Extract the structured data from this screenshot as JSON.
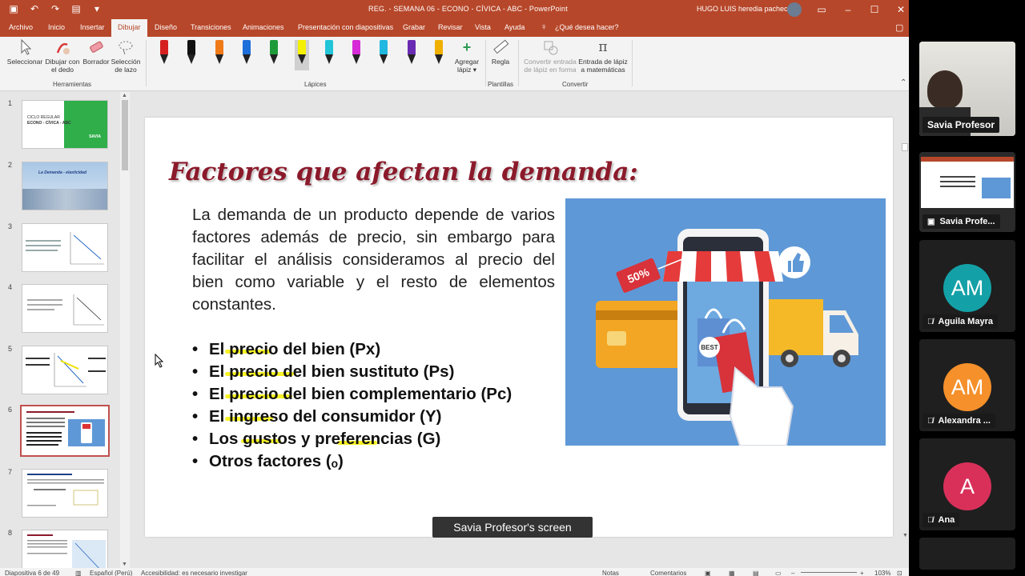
{
  "window": {
    "title": "REG. - SEMANA 06 - ECONO - CÍVICA - ABC  -  PowerPoint",
    "user": "HUGO LUIS heredia pacheco"
  },
  "tabs": [
    "Archivo",
    "Inicio",
    "Insertar",
    "Dibujar",
    "Diseño",
    "Transiciones",
    "Animaciones",
    "Presentación con diapositivas",
    "Grabar",
    "Revisar",
    "Vista",
    "Ayuda"
  ],
  "active_tab": "Dibujar",
  "tell_me": "¿Qué desea hacer?",
  "ribbon": {
    "tools": {
      "select": "Seleccionar",
      "draw_finger_1": "Dibujar con",
      "draw_finger_2": "el dedo",
      "eraser": "Borrador",
      "lasso_1": "Selección",
      "lasso_2": "de lazo",
      "group": "Herramientas"
    },
    "pens_group": "Lápices",
    "add_pen_1": "Agregar",
    "add_pen_2": "lápiz",
    "ruler": "Regla",
    "stencils_group": "Plantillas",
    "convert_shape_1": "Convertir entrada",
    "convert_shape_2": "de lápiz en forma",
    "convert_math_1": "Entrada de lápiz",
    "convert_math_2": "a matemáticas",
    "convert_group": "Convertir",
    "pen_colors": [
      "#d62020",
      "#111111",
      "#f07a18",
      "#1e6fd9",
      "#1e9a3a",
      "#f5f000",
      "#22c5d8",
      "#d62bd6",
      "#20b8e0",
      "#6a2bb3",
      "#f0b000"
    ]
  },
  "thumbnails": {
    "numbers": [
      "1",
      "2",
      "3",
      "4",
      "5",
      "6",
      "7",
      "8"
    ],
    "t1_title": "CICLO REGULAR",
    "t1_sub": "ECONO - CÍVICA - ABC",
    "t1_brand": "SAVIA",
    "t2_title": "La Demanda - elasticidad"
  },
  "slide": {
    "title": "Factores que afectan la demanda:",
    "paragraph": "La demanda de un producto depende de varios factores además de precio, sin embargo para facilitar el análisis consideramos al precio del bien como variable y el resto de elementos constantes.",
    "bullets": [
      "El precio del bien  (Px)",
      "El precio del bien sustituto (Ps)",
      "El precio del bien complementario (Pc)",
      "El ingreso del consumidor (Y)",
      "Los gustos y preferencias (G)",
      "Otros factores (ₒ)"
    ],
    "image": {
      "discount_tag": "50%",
      "badge": "BEST"
    }
  },
  "share_label": "Savia Profesor's screen",
  "status": {
    "slide_counter": "Diapositiva 6 de 49",
    "language": "Español (Perú)",
    "accessibility": "Accesibilidad: es necesario investigar",
    "notes": "Notas",
    "comments": "Comentarios",
    "zoom": "103%"
  },
  "participants": [
    {
      "name": "Savia Profesor",
      "kind": "video"
    },
    {
      "name": "Savia Profe...",
      "kind": "screen"
    },
    {
      "name": "Aguila Mayra",
      "initials": "AM",
      "color": "#13a1a7",
      "muted": true
    },
    {
      "name": "Alexandra ...",
      "initials": "AM",
      "color": "#f5902a",
      "muted": true
    },
    {
      "name": "Ana",
      "initials": "A",
      "color": "#d9305a",
      "muted": true
    }
  ]
}
